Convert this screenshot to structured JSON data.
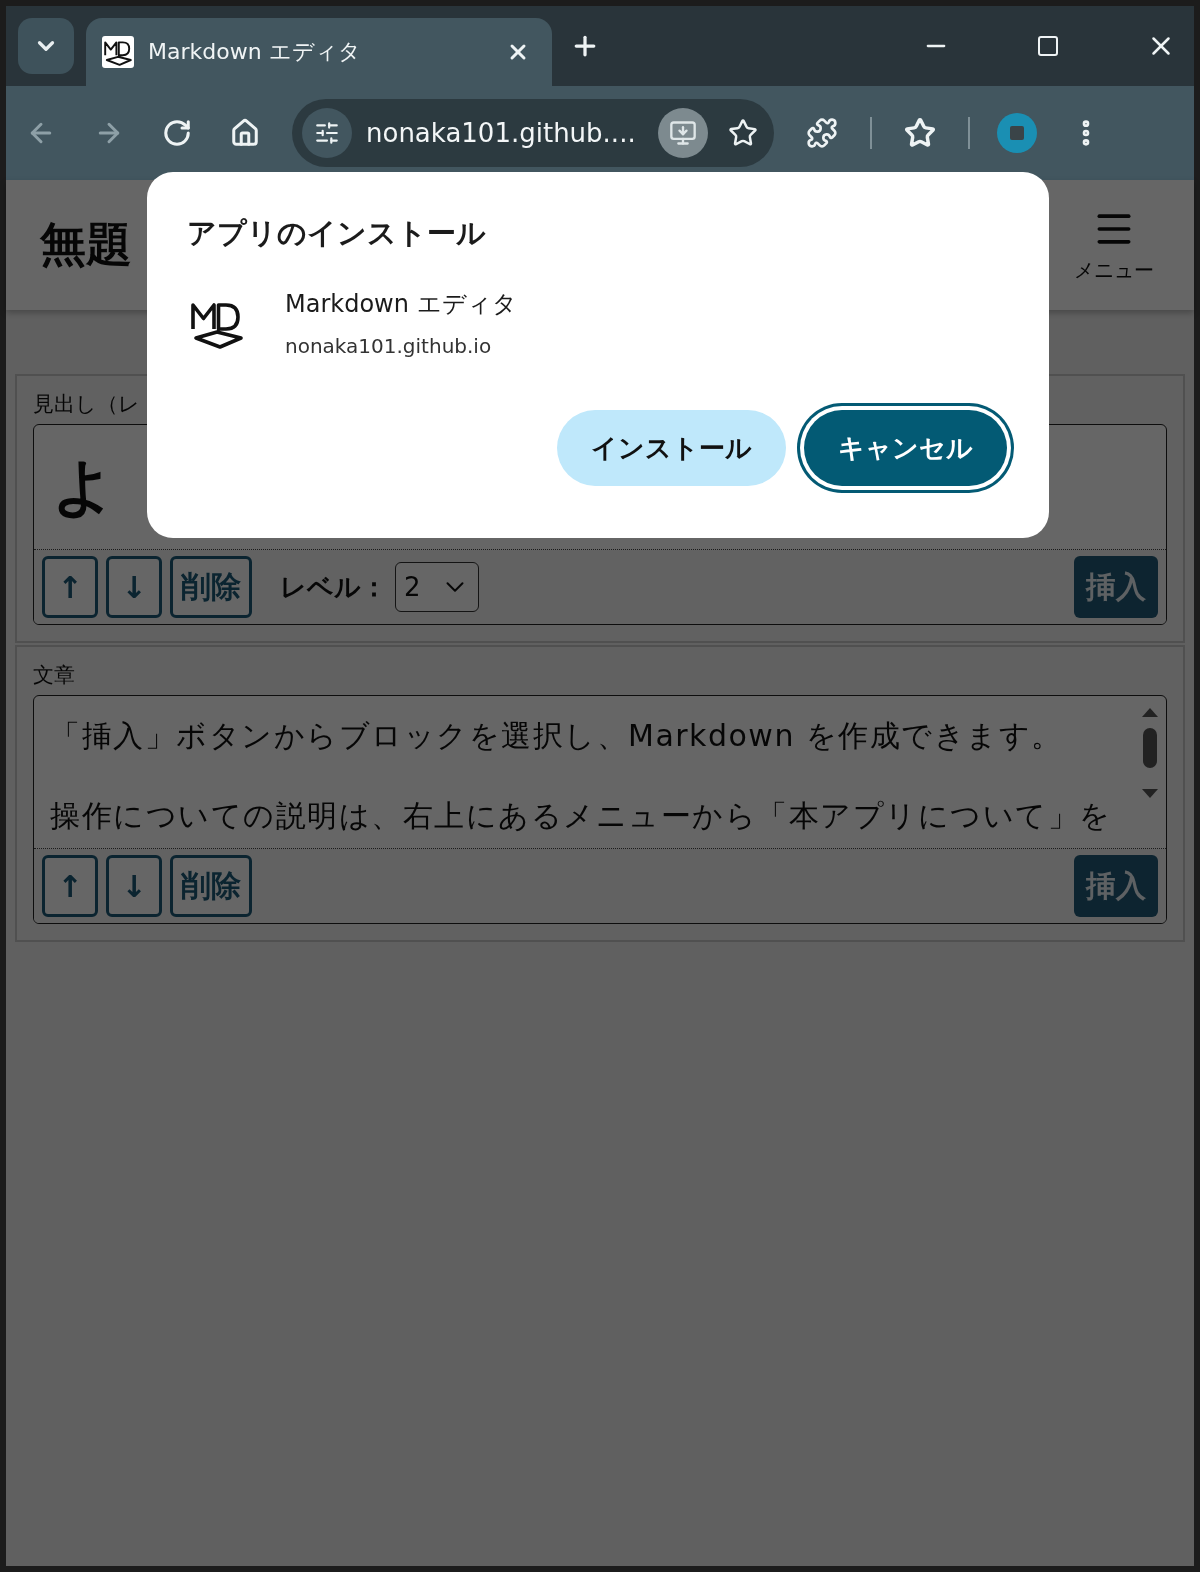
{
  "browser": {
    "tab": {
      "title": "Markdown エディタ",
      "selected": true
    },
    "nav": [
      {
        "kind": "back",
        "disabled": true
      },
      {
        "kind": "forward",
        "disabled": true
      },
      {
        "kind": "reload",
        "disabled": false
      },
      {
        "kind": "home",
        "disabled": false
      }
    ],
    "address": "nonaka101.github...."
  },
  "page": {
    "title": "無題",
    "menu_label": "メニュー",
    "blocks": [
      {
        "kind": "heading",
        "label": "見出し（レ",
        "value": "よ",
        "buttons": [
          "↑",
          "↓",
          "削除"
        ],
        "level_label": "レベル：",
        "level_value": "2",
        "insert": "挿入"
      },
      {
        "kind": "paragraph",
        "label": "文章",
        "paragraphs": [
          "「挿入」ボタンからブロックを選択し、Markdown を作成できます。",
          "操作についての説明は、右上にあるメニューから「本アプリについて」を"
        ],
        "buttons": [
          "↑",
          "↓",
          "削除"
        ],
        "insert": "挿入"
      }
    ]
  },
  "dialog": {
    "title": "アプリのインストール",
    "app_name": "Markdown エディタ",
    "origin": "nonaka101.github.io",
    "buttons": [
      {
        "label": "インストール",
        "kind": "secondary",
        "focused": false
      },
      {
        "label": "キャンセル",
        "kind": "primary",
        "focused": true
      }
    ]
  }
}
